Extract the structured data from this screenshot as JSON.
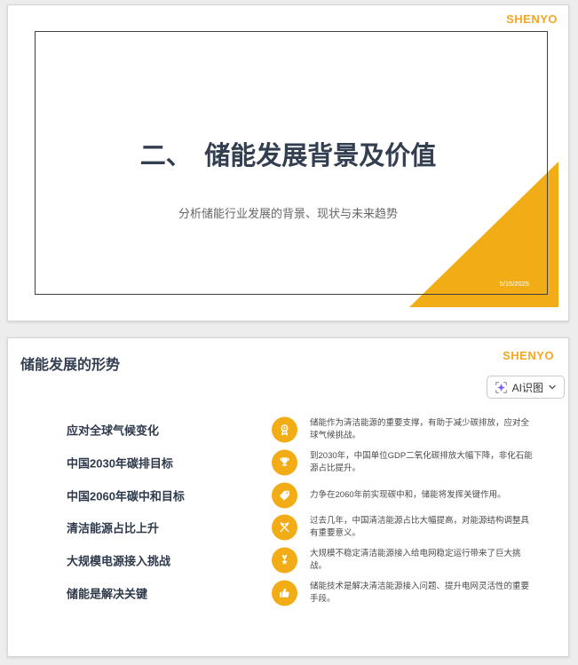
{
  "colors": {
    "accent_yellow": "#F2AC15",
    "logo_orange": "#F5A623",
    "title_dark": "#333F50",
    "frame_border": "#3F3F3F",
    "ai_sparkle_purple": "#7A5AF8",
    "page_background": "#EDEDED"
  },
  "slide1": {
    "logo": "SHENYO",
    "title": "二、　储能发展背景及价值",
    "subtitle": "分析储能行业发展的背景、现状与未来趋势",
    "date": "5/15/2025"
  },
  "slide2": {
    "logo": "SHENYO",
    "title": "储能发展的形势",
    "ai_button": {
      "label": "AI识图"
    },
    "items": [
      {
        "label": "应对全球气候变化",
        "icon": "award-medal-icon",
        "desc": "储能作为清洁能源的重要支撑，有助于减少碳排放，应对全球气候挑战。"
      },
      {
        "label": "中国2030年碳排目标",
        "icon": "trophy-icon",
        "desc": "到2030年，中国单位GDP二氧化碳排放大幅下降，非化石能源占比提升。"
      },
      {
        "label": "中国2060年碳中和目标",
        "icon": "tag-icon",
        "desc": "力争在2060年前实现碳中和，储能将发挥关键作用。"
      },
      {
        "label": "清洁能源占比上升",
        "icon": "crossed-flags-icon",
        "desc": "过去几年，中国清洁能源占比大幅提高，对能源结构调整具有重要意义。"
      },
      {
        "label": "大规模电源接入挑战",
        "icon": "medal-ribbon-icon",
        "desc": "大规模不稳定清洁能源接入给电网稳定运行带来了巨大挑战。"
      },
      {
        "label": "储能是解决关键",
        "icon": "thumbs-up-icon",
        "desc": "储能技术是解决清洁能源接入问题、提升电网灵活性的重要手段。"
      }
    ]
  }
}
